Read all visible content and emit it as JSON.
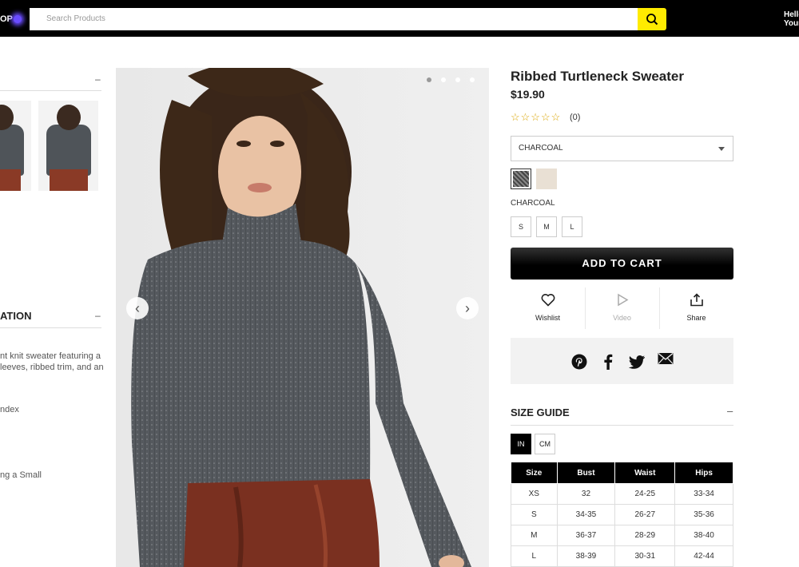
{
  "header": {
    "logo_fragment": "OP",
    "search_placeholder": "Search Products",
    "greeting_line1": "Hello,",
    "greeting_line2": "Your"
  },
  "left": {
    "section_title": "ATION",
    "desc_lines": [
      "nt knit sweater featuring a",
      "leeves, ribbed trim, and an",
      "ndex",
      "ng a Small"
    ]
  },
  "product": {
    "title": "Ribbed Turtleneck Sweater",
    "price": "$19.90",
    "stars": "☆☆☆☆☆",
    "review_count": "(0)",
    "selected_color": "CHARCOAL",
    "color_label": "CHARCOAL",
    "swatches": [
      "charcoal",
      "cream"
    ],
    "sizes": [
      "S",
      "M",
      "L"
    ],
    "add_to_cart": "ADD TO CART",
    "actions": {
      "wishlist": "Wishlist",
      "video": "Video",
      "share": "Share"
    }
  },
  "gallery": {
    "dots": 4,
    "active_dot": 0
  },
  "size_guide": {
    "title": "SIZE GUIDE",
    "collapse_symbol": "–",
    "units": [
      "IN",
      "CM"
    ],
    "active_unit": "IN",
    "columns": [
      "Size",
      "Bust",
      "Waist",
      "Hips"
    ],
    "rows": [
      [
        "XS",
        "32",
        "24-25",
        "33-34"
      ],
      [
        "S",
        "34-35",
        "26-27",
        "35-36"
      ],
      [
        "M",
        "36-37",
        "28-29",
        "38-40"
      ],
      [
        "L",
        "38-39",
        "30-31",
        "42-44"
      ]
    ]
  },
  "colors": {
    "accent_yellow": "#ffeb00",
    "topbar": "#000000",
    "star": "#d9a400"
  }
}
